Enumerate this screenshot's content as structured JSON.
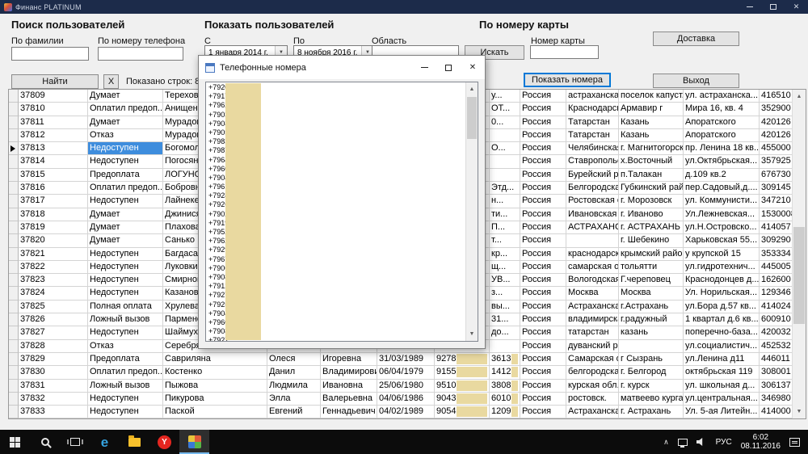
{
  "colors": {
    "titlebar": "#1c2b4a",
    "selection": "#3e8ddd",
    "mask": "#e9d9a0",
    "focus": "#0078d7",
    "taskbar": "#0c0c0c"
  },
  "window": {
    "title": "Финанс PLATINUM"
  },
  "search_users": {
    "title": "Поиск пользователей",
    "surname_label": "По фамилии",
    "phone_label": "По номеру телефона",
    "find_button": "Найти",
    "clear_button": "X",
    "rows_shown": "Показано строк: 86"
  },
  "show_users": {
    "title": "Показать пользователей",
    "from_label": "С",
    "from_value": "1  января  2014 г.",
    "to_label": "По",
    "to_value": "8  ноября  2016 г.",
    "region_label": "Область",
    "search_button": "Искать"
  },
  "card_section": {
    "title": "По номеру карты",
    "card_label": "Номер карты",
    "show_numbers_button": "Показать номера",
    "delivery_button": "Доставка",
    "exit_button": "Выход"
  },
  "dialog": {
    "title": "Телефонные номера",
    "phones": [
      "+7920",
      "+7917",
      "+7962",
      "+7903",
      "+7908",
      "+7905",
      "+7983",
      "+7987",
      "+7964",
      "+7960",
      "+7904",
      "+7961",
      "+7928",
      "+7926",
      "+7902",
      "+7919",
      "+7952",
      "+7962",
      "+7929",
      "+7967",
      "+7906",
      "+7908",
      "+7912",
      "+7927",
      "+7925",
      "+7904",
      "+7960",
      "+7908",
      "+7927"
    ]
  },
  "grid": {
    "rows": [
      {
        "id": "37809",
        "status": "Думает",
        "surname": "Терехов",
        "name": "",
        "patr": "",
        "dob": "",
        "phone": "",
        "code": "у...",
        "country": "Россия",
        "region": "астраханская о...",
        "city": "поселок капуст...",
        "address": "ул. астраханска...",
        "zip": "416510",
        "selected": false,
        "masked": false
      },
      {
        "id": "37810",
        "status": "Оплатил предоп...",
        "surname": "Анищенко",
        "name": "",
        "patr": "",
        "dob": "",
        "phone": "",
        "code": "ОТ...",
        "country": "Россия",
        "region": "Краснодарский ...",
        "city": "Армавир г",
        "address": "Мира 16, кв. 4",
        "zip": "352900",
        "selected": false,
        "masked": false
      },
      {
        "id": "37811",
        "status": "Думает",
        "surname": "Мурадов",
        "name": "",
        "patr": "",
        "dob": "",
        "phone": "",
        "code": "0...",
        "country": "Россия",
        "region": "Татарстан",
        "city": "Казань",
        "address": "Апоратского",
        "zip": "420126",
        "selected": false,
        "masked": false
      },
      {
        "id": "37812",
        "status": "Отказ",
        "surname": "Мурадов",
        "name": "",
        "patr": "",
        "dob": "",
        "phone": "",
        "code": "",
        "country": "Россия",
        "region": "Татарстан",
        "city": "Казань",
        "address": "Апоратского",
        "zip": "420126",
        "selected": false,
        "masked": false
      },
      {
        "id": "37813",
        "status": "Недоступен",
        "surname": "Богомолов",
        "name": "",
        "patr": "",
        "dob": "",
        "phone": "",
        "code": "О...",
        "country": "Россия",
        "region": "Челябинская об...",
        "city": "г. Магнитогорск",
        "address": "пр. Ленина 18 кв...",
        "zip": "455000",
        "selected": true,
        "masked": false
      },
      {
        "id": "37814",
        "status": "Недоступен",
        "surname": "Погосян",
        "name": "",
        "patr": "",
        "dob": "",
        "phone": "",
        "code": "",
        "country": "Россия",
        "region": "Ставропольски...",
        "city": "х.Восточный",
        "address": "ул.Октябрьская...",
        "zip": "357925",
        "selected": false,
        "masked": false
      },
      {
        "id": "37815",
        "status": "Предоплата",
        "surname": "ЛОГУНОВ",
        "name": "",
        "patr": "",
        "dob": "",
        "phone": "",
        "code": "",
        "country": "Россия",
        "region": "Бурейский район",
        "city": "п.Талакан",
        "address": "д.109 кв.2",
        "zip": "676730",
        "selected": false,
        "masked": false
      },
      {
        "id": "37816",
        "status": "Оплатил предоп...",
        "surname": "Бобровникова",
        "name": "",
        "patr": "",
        "dob": "",
        "phone": "",
        "code": "Этд...",
        "country": "Россия",
        "region": "Белгородская",
        "city": "Губкинский рай...",
        "address": "пер.Садовый,д....",
        "zip": "309145",
        "selected": false,
        "masked": false
      },
      {
        "id": "37817",
        "status": "Недоступен",
        "surname": "Лайнекер",
        "name": "",
        "patr": "",
        "dob": "",
        "phone": "",
        "code": "н...",
        "country": "Россия",
        "region": "Ростовская обл.",
        "city": "г. Морозовск",
        "address": "ул. Коммунисти...",
        "zip": "347210",
        "selected": false,
        "masked": false
      },
      {
        "id": "37818",
        "status": "Думает",
        "surname": "Джинисян",
        "name": "",
        "patr": "",
        "dob": "",
        "phone": "",
        "code": "ти...",
        "country": "Россия",
        "region": "Ивановская обл.",
        "city": "г. Иваново",
        "address": "Ул.Лежневская...",
        "zip": "1530008",
        "selected": false,
        "masked": false
      },
      {
        "id": "37819",
        "status": "Думает",
        "surname": "Плахова",
        "name": "",
        "patr": "",
        "dob": "",
        "phone": "",
        "code": "П...",
        "country": "Россия",
        "region": "АСТРАХАНСКА...",
        "city": "г. АСТРАХАНЬ",
        "address": "ул.Н.Островско...",
        "zip": "414057",
        "selected": false,
        "masked": false
      },
      {
        "id": "37820",
        "status": "Думает",
        "surname": "Санько",
        "name": "",
        "patr": "",
        "dob": "",
        "phone": "",
        "code": "т...",
        "country": "Россия",
        "region": "",
        "city": "г. Шебекино",
        "address": "Харьковская 55...",
        "zip": "309290",
        "selected": false,
        "masked": false
      },
      {
        "id": "37821",
        "status": "Недоступен",
        "surname": "Багдасарян",
        "name": "",
        "patr": "",
        "dob": "",
        "phone": "",
        "code": "кр...",
        "country": "Россия",
        "region": "краснодарский ...",
        "city": "крымский райо...",
        "address": "у крупской 15",
        "zip": "353334",
        "selected": false,
        "masked": false
      },
      {
        "id": "37822",
        "status": "Недоступен",
        "surname": "Луковкина",
        "name": "",
        "patr": "",
        "dob": "",
        "phone": "",
        "code": "щ...",
        "country": "Россия",
        "region": "самарская обл.",
        "city": "тольятти",
        "address": "ул.гидротехнич...",
        "zip": "445005",
        "selected": false,
        "masked": false
      },
      {
        "id": "37823",
        "status": "Недоступен",
        "surname": "Смирнов",
        "name": "",
        "patr": "",
        "dob": "",
        "phone": "",
        "code": "УВ...",
        "country": "Россия",
        "region": "Вологодская",
        "city": "Г.череповец",
        "address": "Краснодонцев д...",
        "zip": "162600",
        "selected": false,
        "masked": false
      },
      {
        "id": "37824",
        "status": "Недоступен",
        "surname": "Казанова",
        "name": "",
        "patr": "",
        "dob": "",
        "phone": "",
        "code": "з...",
        "country": "Россия",
        "region": "Москва",
        "city": "Москва",
        "address": "Ул. Норильская...",
        "zip": "129346",
        "selected": false,
        "masked": false
      },
      {
        "id": "37825",
        "status": "Полная оплата",
        "surname": "Хрулева",
        "name": "",
        "patr": "",
        "dob": "",
        "phone": "",
        "code": "вы...",
        "country": "Россия",
        "region": "Астраханская о...",
        "city": "г.Астрахань",
        "address": "ул.Бора д.57 кв...",
        "zip": "414024",
        "selected": false,
        "masked": false
      },
      {
        "id": "37826",
        "status": "Ложный вызов",
        "surname": "Парменов",
        "name": "",
        "patr": "",
        "dob": "",
        "phone": "",
        "code": "31...",
        "country": "Россия",
        "region": "владимирская",
        "city": "г.радужный",
        "address": "1 квартал д.6 кв...",
        "zip": "600910",
        "selected": false,
        "masked": false
      },
      {
        "id": "37827",
        "status": "Недоступен",
        "surname": "Шаймухаметов",
        "name": "",
        "patr": "",
        "dob": "",
        "phone": "",
        "code": "до...",
        "country": "Россия",
        "region": "татарстан",
        "city": "казань",
        "address": "поперечно-база...",
        "zip": "420032",
        "selected": false,
        "masked": false
      },
      {
        "id": "37828",
        "status": "Отказ",
        "surname": "Серебряков",
        "name": "",
        "patr": "",
        "dob": "",
        "phone": "",
        "code": "",
        "country": "Россия",
        "region": "дуванский р-он",
        "city": "",
        "address": "ул.социалистич...",
        "zip": "452532",
        "selected": false,
        "masked": false
      },
      {
        "id": "37829",
        "status": "Предоплата",
        "surname": "Савриляна",
        "name": "Олеся",
        "patr": "Игоревна",
        "dob": "31/03/1989",
        "phone": "9278",
        "code": "3613",
        "country": "Россия",
        "region": "Самарская обл",
        "city": "г Сызрань",
        "address": "ул.Ленина д11",
        "zip": "446011",
        "selected": false,
        "masked": true
      },
      {
        "id": "37830",
        "status": "Оплатил предоп...",
        "surname": "Костенко",
        "name": "Данил",
        "patr": "Владимирович",
        "dob": "06/04/1979",
        "phone": "9155",
        "code": "1412",
        "country": "Россия",
        "region": "белгородская о...",
        "city": "г. Белгород",
        "address": "октябрьская 119",
        "zip": "308001",
        "selected": false,
        "masked": true
      },
      {
        "id": "37831",
        "status": "Ложный вызов",
        "surname": "Пыжова",
        "name": "Людмила",
        "patr": "Ивановна",
        "dob": "25/06/1980",
        "phone": "9510",
        "code": "3808",
        "country": "Россия",
        "region": "курская обл.",
        "city": "г. курск",
        "address": "ул. школьная д...",
        "zip": "306137",
        "selected": false,
        "masked": true
      },
      {
        "id": "37832",
        "status": "Недоступен",
        "surname": "Пикурова",
        "name": "Элла",
        "patr": "Валерьевна",
        "dob": "04/06/1986",
        "phone": "9043",
        "code": "6010",
        "country": "Россия",
        "region": "ростовск.",
        "city": "матвеево курган",
        "address": "ул.центральная...",
        "zip": "346980",
        "selected": false,
        "masked": true
      },
      {
        "id": "37833",
        "status": "Недоступен",
        "surname": "Паской",
        "name": "Евгений",
        "patr": "Геннадьевич",
        "dob": "04/02/1989",
        "phone": "9054",
        "code": "1209",
        "country": "Россия",
        "region": "Астраханская о...",
        "city": "г. Астрахань",
        "address": "Ул. 5-ая Литейн...",
        "zip": "414000",
        "selected": false,
        "masked": true
      }
    ]
  },
  "taskbar": {
    "lang": "РУС",
    "time": "6:02",
    "date": "08.11.2016"
  }
}
